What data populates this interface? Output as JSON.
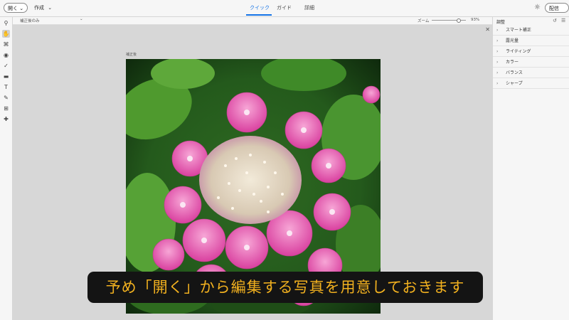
{
  "topbar": {
    "open_button": "開く",
    "create_menu": "作成",
    "tabs": [
      {
        "label": "クイック",
        "active": true
      },
      {
        "label": "ガイド",
        "active": false
      },
      {
        "label": "詳細",
        "active": false
      }
    ],
    "share_button": "配信"
  },
  "subbar": {
    "view_select": "補正後のみ",
    "zoom_label": "ズーム",
    "zoom_value": "93%",
    "zoom_fraction": 0.93
  },
  "canvas": {
    "image_label": "補正後"
  },
  "panel": {
    "title": "調整",
    "items": [
      {
        "label": "スマート補正"
      },
      {
        "label": "露光量"
      },
      {
        "label": "ライティング"
      },
      {
        "label": "カラー"
      },
      {
        "label": "バランス"
      },
      {
        "label": "シャープ"
      }
    ]
  },
  "caption": {
    "text": "予め「開く」から編集する写真を用意しておきます"
  },
  "colors": {
    "accent": "#1473e6",
    "caption_text": "#f2b11f",
    "caption_bg": "#141414"
  }
}
